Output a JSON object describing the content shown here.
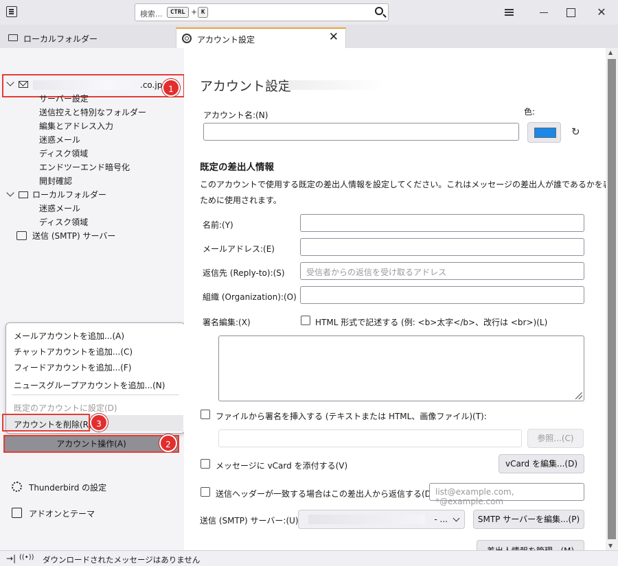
{
  "titlebar": {
    "search_placeholder": "検索...",
    "search_kbd_ctrl": "CTRL",
    "search_kbd_plus": "+",
    "search_kbd_k": "K",
    "close_glyph": "✕"
  },
  "tabs": [
    {
      "label": "ローカルフォルダー"
    },
    {
      "label": "アカウント設定",
      "close_glyph": "✕"
    }
  ],
  "sidebar": {
    "account_email_visible": ".co.jp",
    "account_items": [
      "サーバー設定",
      "送信控えと特別なフォルダー",
      "編集とアドレス入力",
      "迷惑メール",
      "ディスク領域",
      "エンドツーエンド暗号化",
      "開封確認"
    ],
    "local_folder_label": "ローカルフォルダー",
    "local_items": [
      "迷惑メール",
      "ディスク領域"
    ],
    "smtp_label": "送信 (SMTP) サーバー",
    "badge_1": "1",
    "badge_2": "2",
    "badge_3": "3"
  },
  "context_menu": {
    "items": [
      "メールアカウントを追加...(A)",
      "チャットアカウントを追加...(C)",
      "フィードアカウントを追加...(F)",
      "ニュースグループアカウントを追加...(N)"
    ],
    "set_default": "既定のアカウントに設定(D)",
    "delete_account": "アカウントを削除(R)"
  },
  "account_action_button": "アカウント操作(A)",
  "bottom": {
    "settings": "Thunderbird の設定",
    "addons": "アドオンとテーマ"
  },
  "statusbar": {
    "text": "ダウンロードされたメッセージはありません"
  },
  "main": {
    "title": "アカウント設定 - ",
    "account_name_label": "アカウント名:(N)",
    "color_label": "色:",
    "color_value": "#1b88e8",
    "identity_heading": "既定の差出人情報",
    "identity_desc_1": "このアカウントで使用する既定の差出人情報を設定してください。これはメッセージの差出人が誰であるかを表す",
    "identity_desc_2": "ために使用されます。",
    "name_label": "名前:(Y)",
    "email_label": "メールアドレス:(E)",
    "replyto_label": "返信先 (Reply-to):(S)",
    "replyto_placeholder": "受信者からの返信を受け取るアドレス",
    "org_label": "組織 (Organization):(O)",
    "sig_label": "署名編集:(X)",
    "sig_html_checkbox": "HTML 形式で記述する (例: <b>太字</b>、改行は <br>)(L)",
    "sig_file_checkbox": "ファイルから署名を挿入する (テキストまたは HTML、画像ファイル)(T):",
    "browse_button": "参照...(C)",
    "vcard_checkbox": "メッセージに vCard を添付する(V)",
    "vcard_button": "vCard を編集...(D)",
    "reply_header_checkbox": "送信ヘッダーが一致する場合はこの差出人から返信する(D):",
    "reply_header_placeholder": "list@example.com, *@example.com",
    "smtp_label": "送信 (SMTP) サーバー:(U)",
    "smtp_select_ellipsis": "- ...",
    "smtp_edit_button": "SMTP サーバーを編集...(P)",
    "manage_identities_button": "差出人情報を管理...(M)"
  }
}
